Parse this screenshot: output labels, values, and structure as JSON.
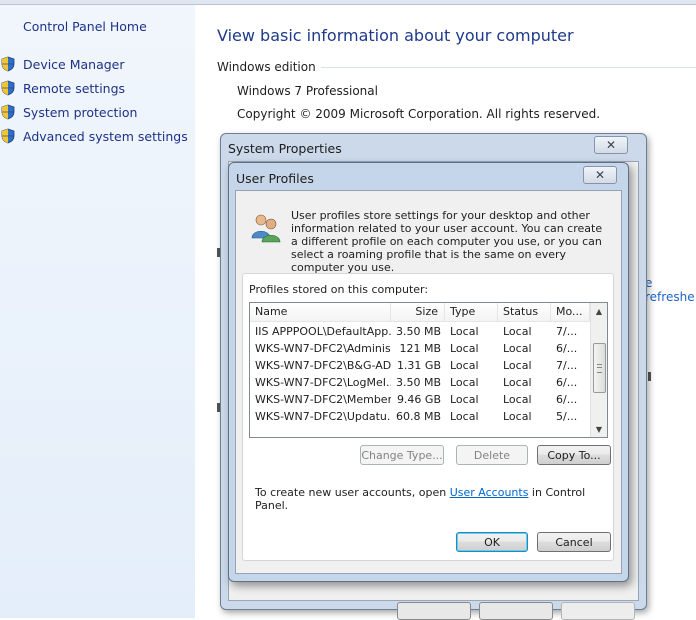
{
  "control_panel": {
    "home_label": "Control Panel Home",
    "sidebar_links": [
      {
        "label": "Device Manager",
        "icon": "shield-icon"
      },
      {
        "label": "Remote settings",
        "icon": "shield-icon"
      },
      {
        "label": "System protection",
        "icon": "shield-icon"
      },
      {
        "label": "Advanced system settings",
        "icon": "shield-icon"
      }
    ],
    "page_title": "View basic information about your computer",
    "edition_heading": "Windows edition",
    "edition": "Windows 7 Professional",
    "copyright": "Copyright © 2009 Microsoft Corporation.  All rights reserved.",
    "partial_link": "e refreshe"
  },
  "system_properties": {
    "title": "System Properties",
    "close_glyph": "✕"
  },
  "user_profiles": {
    "title": "User Profiles",
    "close_glyph": "✕",
    "description": "User profiles store settings for your desktop and other information related to your user account. You can create a different profile on each computer you use, or you can select a roaming profile that is the same on every computer you use.",
    "group_label": "Profiles stored on this computer:",
    "columns": [
      "Name",
      "Size",
      "Type",
      "Status",
      "Mo..."
    ],
    "rows": [
      {
        "name": "IIS APPPOOL\\DefaultApp...",
        "size": "3.50 MB",
        "type": "Local",
        "status": "Local",
        "modified": "7/..."
      },
      {
        "name": "WKS-WN7-DFC2\\Adminis...",
        "size": "121 MB",
        "type": "Local",
        "status": "Local",
        "modified": "6/..."
      },
      {
        "name": "WKS-WN7-DFC2\\B&G-AD...",
        "size": "1.31 GB",
        "type": "Local",
        "status": "Local",
        "modified": "7/..."
      },
      {
        "name": "WKS-WN7-DFC2\\LogMeI...",
        "size": "3.50 MB",
        "type": "Local",
        "status": "Local",
        "modified": "6/..."
      },
      {
        "name": "WKS-WN7-DFC2\\Member",
        "size": "9.46 GB",
        "type": "Local",
        "status": "Local",
        "modified": "6/..."
      },
      {
        "name": "WKS-WN7-DFC2\\Updatu...",
        "size": "60.8 MB",
        "type": "Local",
        "status": "Local",
        "modified": "5/..."
      }
    ],
    "buttons": {
      "change_type": "Change Type...",
      "delete": "Delete",
      "copy_to": "Copy To...",
      "ok": "OK",
      "cancel": "Cancel"
    },
    "create_text_before": "To create new user accounts, open ",
    "create_link": "User Accounts",
    "create_text_after": " in Control Panel."
  }
}
